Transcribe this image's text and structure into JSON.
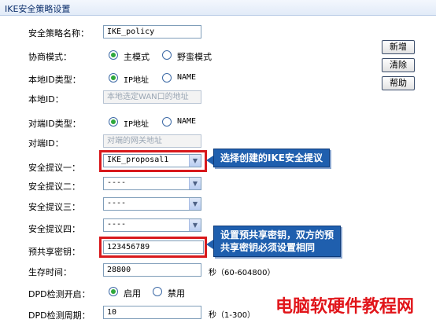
{
  "panel": {
    "title": "IKE安全策略设置"
  },
  "buttons": {
    "add": "新增",
    "clear": "清除",
    "help": "帮助"
  },
  "fields": {
    "policy_name": {
      "label": "安全策略名称：",
      "value": "IKE_policy"
    },
    "mode": {
      "label": "协商模式：",
      "options": [
        "主模式",
        "野蛮模式"
      ],
      "selected": "主模式"
    },
    "local_id_type": {
      "label": "本地ID类型：",
      "options": [
        "IP地址",
        "NAME"
      ],
      "selected": "IP地址"
    },
    "local_id": {
      "label": "本地ID：",
      "placeholder": "本地选定WAN口的地址"
    },
    "peer_id_type": {
      "label": "对端ID类型：",
      "options": [
        "IP地址",
        "NAME"
      ],
      "selected": "IP地址"
    },
    "peer_id": {
      "label": "对端ID：",
      "placeholder": "对端的网关地址"
    },
    "proposal1": {
      "label": "安全提议一：",
      "value": "IKE_proposal1"
    },
    "proposal2": {
      "label": "安全提议二：",
      "value": "----"
    },
    "proposal3": {
      "label": "安全提议三：",
      "value": "----"
    },
    "proposal4": {
      "label": "安全提议四：",
      "value": "----"
    },
    "psk": {
      "label": "预共享密钥：",
      "value": "123456789"
    },
    "lifetime": {
      "label": "生存时间：",
      "value": "28800",
      "unit": "秒（60-604800）"
    },
    "dpd_enable": {
      "label": "DPD检测开启：",
      "options": [
        "启用",
        "禁用"
      ],
      "selected": "启用"
    },
    "dpd_period": {
      "label": "DPD检测周期：",
      "value": "10",
      "unit": "秒（1-300）"
    }
  },
  "annotations": {
    "callout1": "选择创建的IKE安全提议",
    "callout2_line1": "设置预共享密钥，双方的预",
    "callout2_line2": "共享密钥必须设置相同"
  },
  "watermark": "电脑软硬件教程网",
  "colors": {
    "highlight": "#d8191c",
    "callout_bg": "#1f5fae",
    "watermark": "#e1151a",
    "radio_checked": "#2fa83c"
  }
}
